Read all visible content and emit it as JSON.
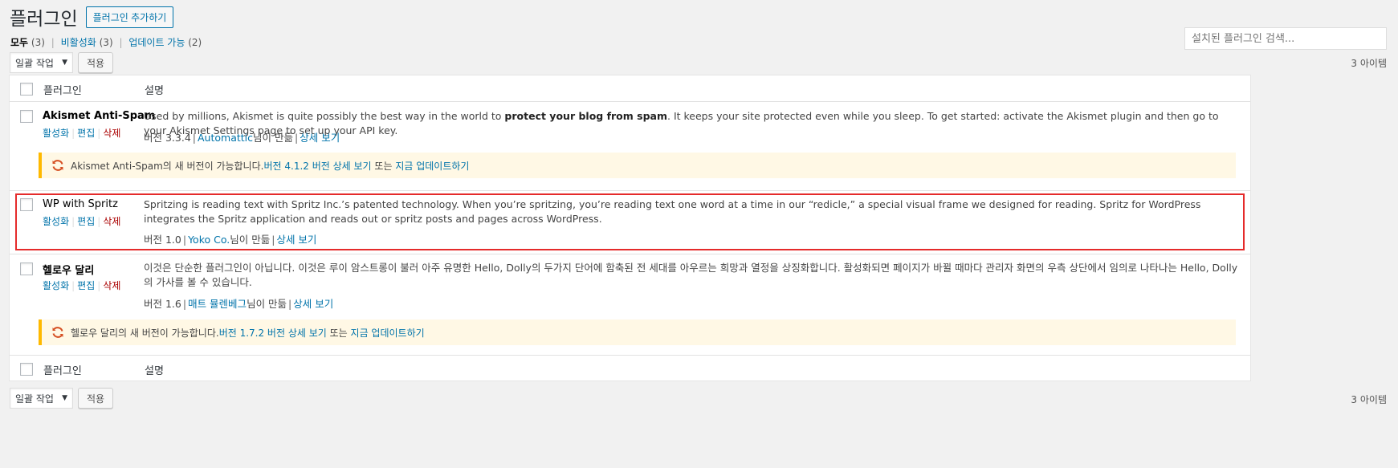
{
  "header": {
    "title": "플러그인",
    "add_new": "플러그인 추가하기"
  },
  "filters": {
    "all": "모두",
    "all_count": "(3)",
    "inactive": "비활성화",
    "inactive_count": "(3)",
    "update": "업데이트 가능",
    "update_count": "(2)"
  },
  "search": {
    "placeholder": "설치된 플러그인 검색..."
  },
  "tablenav": {
    "bulk_label": "일괄 작업",
    "apply_label": "적용",
    "items_count": "3 아이템"
  },
  "table": {
    "col_name": "플러그인",
    "col_desc": "설명"
  },
  "plugins": [
    {
      "name": "Akismet Anti-Spam",
      "actions": [
        "활성화",
        "편집",
        "삭제"
      ],
      "desc_pre": "Used by millions, Akismet is quite possibly the best way in the world to ",
      "desc_bold": "protect your blog from spam",
      "desc_post": ". It keeps your site protected even while you sleep. To get started: activate the Akismet plugin and then go to your Akismet Settings page to set up your API key.",
      "version": "버전 3.3.4",
      "author": "Automattic",
      "by_suffix": "님이 만듦",
      "details": "상세 보기",
      "update": {
        "pre": "Akismet Anti-Spam의 새 버전이 가능합니다. ",
        "link1": "버전 4.1.2 버전 상세 보기",
        "mid": " 또는 ",
        "link2": "지금 업데이트하기"
      }
    },
    {
      "name": "WP with Spritz",
      "actions": [
        "활성화",
        "편집",
        "삭제"
      ],
      "desc": "Spritzing is reading text with Spritz Inc.’s patented technology. When you’re spritzing, you’re reading text one word at a time in our “redicle,” a special visual frame we designed for reading. Spritz for WordPress integrates the Spritz application and reads out or spritz posts and pages across WordPress.",
      "version": "버전 1.0",
      "author": "Yoko Co.",
      "by_suffix": "님이 만듦",
      "details": "상세 보기"
    },
    {
      "name": "헬로우 달리",
      "actions": [
        "활성화",
        "편집",
        "삭제"
      ],
      "desc": "이것은 단순한 플러그인이 아닙니다. 이것은 루이 암스트롱이 불러 아주 유명한 Hello, Dolly의 두가지 단어에 함축된 전 세대를 아우르는 희망과 열정을 상징화합니다. 활성화되면 페이지가 바뀔 때마다 관리자 화면의 우측 상단에서 임의로 나타나는 Hello, Dolly의 가사를 볼 수 있습니다.",
      "version": "버전 1.6",
      "author": "매트 뮬렌베그",
      "by_suffix": "님이 만듦",
      "details": "상세 보기",
      "update": {
        "pre": "헬로우 달리의 새 버전이 가능합니다. ",
        "link1": "버전 1.7.2 버전 상세 보기",
        "mid": " 또는 ",
        "link2": "지금 업데이트하기"
      }
    }
  ],
  "colors": {
    "link": "#0073aa",
    "delete": "#a00000",
    "notice_border": "#ffb900",
    "notice_bg": "#fff8e5",
    "highlight": "#e52b2b",
    "update_icon": "#d54e21"
  },
  "icons": {
    "update": "update-refresh-icon"
  }
}
